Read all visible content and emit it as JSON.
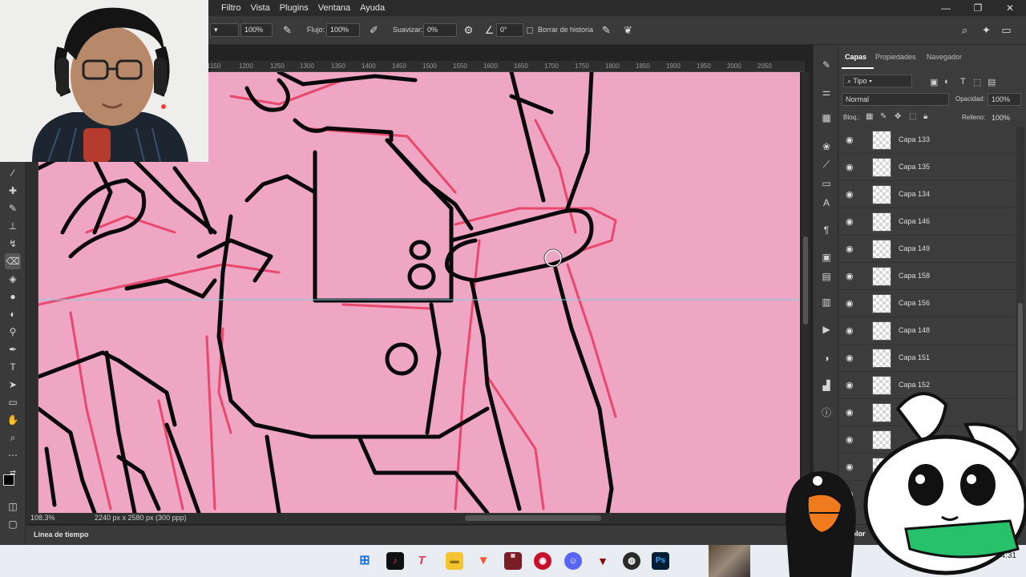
{
  "menubar": {
    "items": [
      "Filtro",
      "Vista",
      "Plugins",
      "Ventana",
      "Ayuda"
    ],
    "window_controls": [
      "minimize-icon",
      "restore-icon",
      "close-icon"
    ]
  },
  "options": {
    "opacity_value": "100%",
    "flow_label": "Flujo:",
    "flow_value": "100%",
    "smoothing_label": "Suavizar:",
    "smoothing_value": "0%",
    "angle_value": "0°",
    "erase_history_label": "Borrar de historia"
  },
  "ruler": {
    "ticks": [
      "1150",
      "1200",
      "1250",
      "1300",
      "1350",
      "1400",
      "1450",
      "1500",
      "1550",
      "1600",
      "1650",
      "1700",
      "1750",
      "1800",
      "1850",
      "1900",
      "1950",
      "2000",
      "2050"
    ]
  },
  "status": {
    "zoom": "108.3%",
    "doc_info": "2240 px x 2580 px (300 ppp)"
  },
  "timeline": {
    "label": "Línea de tiempo"
  },
  "panels": {
    "tabs": [
      "Capas",
      "Propiedades",
      "Navegador"
    ],
    "filter_label": "Tipo",
    "blend_mode": "Normal",
    "opacity_label": "Opacidad:",
    "opacity_value": "100%",
    "lock_label": "Bloq.:",
    "fill_label": "Relleno:",
    "fill_value": "100%",
    "color_tab": "Color"
  },
  "layers": [
    {
      "name": "Capa 133"
    },
    {
      "name": "Capa 135"
    },
    {
      "name": "Capa 134"
    },
    {
      "name": "Capa 146"
    },
    {
      "name": "Capa 149"
    },
    {
      "name": "Capa 158"
    },
    {
      "name": "Capa 156"
    },
    {
      "name": "Capa 148"
    },
    {
      "name": "Capa 151"
    },
    {
      "name": "Capa 152"
    },
    {
      "name": ""
    },
    {
      "name": ""
    },
    {
      "name": ""
    },
    {
      "name": ""
    }
  ],
  "taskbar": {
    "clock": "04:31",
    "apps": [
      "windows-start-icon",
      "tiktok-icon",
      "typora-icon",
      "file-explorer-icon",
      "brave-icon",
      "voicemeeter-icon",
      "app-red-icon",
      "discord-icon",
      "app-dark-icon",
      "obs-icon",
      "photoshop-icon"
    ]
  },
  "colors": {
    "canvas": "#efa6c3",
    "ui_dark": "#3a3a3a",
    "accent": "#31a8ff"
  }
}
